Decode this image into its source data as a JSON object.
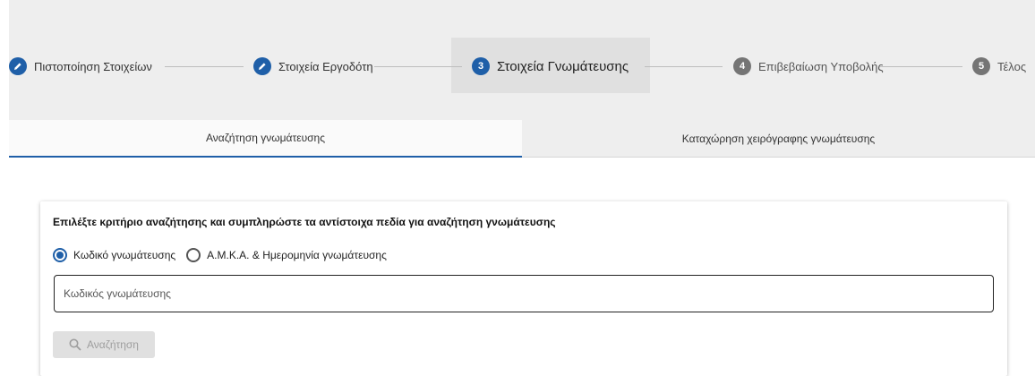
{
  "stepper": {
    "steps": [
      {
        "number": "",
        "label": "Πιστοποίηση Στοιχείων",
        "state": "done",
        "icon": "pencil-icon"
      },
      {
        "number": "",
        "label": "Στοιχεία Εργοδότη",
        "state": "done",
        "icon": "pencil-icon"
      },
      {
        "number": "3",
        "label": "Στοιχεία Γνωμάτευσης",
        "state": "active"
      },
      {
        "number": "4",
        "label": "Επιβεβαίωση Υποβολής",
        "state": "todo"
      },
      {
        "number": "5",
        "label": "Τέλος",
        "state": "todo"
      }
    ]
  },
  "tabs": [
    {
      "label": "Αναζήτηση γνωμάτευσης",
      "active": true
    },
    {
      "label": "Καταχώρηση χειρόγραφης γνωμάτευσης",
      "active": false
    }
  ],
  "search_card": {
    "title": "Επιλέξτε κριτήριο αναζήτησης και συμπληρώστε τα αντίστοιχα πεδία για αναζήτηση γνωμάτευσης",
    "criteria": [
      {
        "label": "Κωδικό γνωμάτευσης",
        "selected": true
      },
      {
        "label": "Α.Μ.Κ.Α. & Ημερομηνία γνωμάτευσης",
        "selected": false
      }
    ],
    "code_field": {
      "placeholder": "Κωδικός γνωμάτευσης",
      "value": ""
    },
    "search_button": {
      "label": "Αναζήτηση",
      "icon": "search-icon",
      "enabled": false
    }
  },
  "colors": {
    "accent": "#1f5fa8",
    "step_todo": "#757575",
    "panel_bg": "#eeeeee"
  }
}
